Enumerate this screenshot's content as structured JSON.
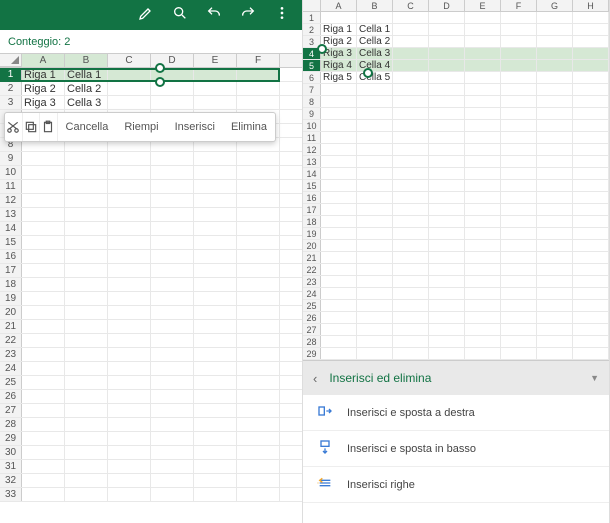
{
  "left": {
    "count_label": "Conteggio: 2",
    "columns": [
      "A",
      "B",
      "C",
      "D",
      "E",
      "F"
    ],
    "rows": [
      {
        "n": 1,
        "cells": [
          "Riga 1",
          "Cella 1",
          "",
          "",
          "",
          ""
        ],
        "selected": true
      },
      {
        "n": 2,
        "cells": [
          "Riga 2",
          "Cella 2",
          "",
          "",
          "",
          ""
        ],
        "selected": false
      },
      {
        "n": 3,
        "cells": [
          "Riga 3",
          "Cella 3",
          "",
          "",
          "",
          ""
        ],
        "selected": false
      }
    ],
    "empty_row_start": 6,
    "empty_row_end": 33,
    "ctx": {
      "cancel": "Cancella",
      "fill": "Riempi",
      "insert": "Inserisci",
      "delete": "Elimina"
    }
  },
  "right": {
    "columns": [
      "A",
      "B",
      "C",
      "D",
      "E",
      "F",
      "G",
      "H"
    ],
    "rows": [
      {
        "n": 1,
        "cells": [
          "",
          "",
          "",
          "",
          "",
          "",
          "",
          ""
        ],
        "selected": false
      },
      {
        "n": 2,
        "cells": [
          "Riga 1",
          "Cella 1",
          "",
          "",
          "",
          "",
          "",
          ""
        ],
        "selected": false
      },
      {
        "n": 3,
        "cells": [
          "Riga 2",
          "Cella 2",
          "",
          "",
          "",
          "",
          "",
          ""
        ],
        "selected": false
      },
      {
        "n": 4,
        "cells": [
          "Riga 3",
          "Cella 3",
          "",
          "",
          "",
          "",
          "",
          ""
        ],
        "selected": true
      },
      {
        "n": 5,
        "cells": [
          "Riga 4",
          "Cella 4",
          "",
          "",
          "",
          "",
          "",
          ""
        ],
        "selected": true
      },
      {
        "n": 6,
        "cells": [
          "Riga 5",
          "Cella 5",
          "",
          "",
          "",
          "",
          "",
          ""
        ],
        "selected": false
      }
    ],
    "empty_row_start": 7,
    "empty_row_end": 29,
    "panel": {
      "title": "Inserisci ed elimina",
      "items": [
        "Inserisci e sposta a destra",
        "Inserisci e sposta in basso",
        "Inserisci righe"
      ]
    }
  }
}
